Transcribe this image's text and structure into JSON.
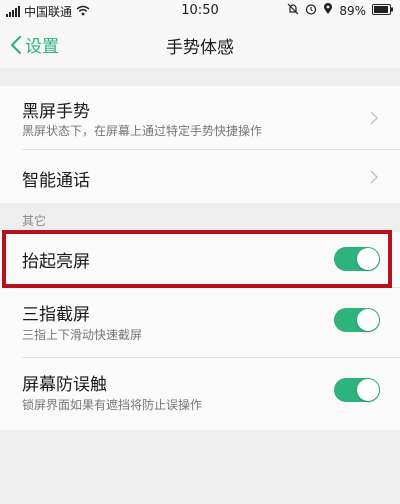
{
  "status_bar": {
    "carrier": "中国联通",
    "time": "10:50",
    "battery": "89%",
    "icons": [
      "signal-icon",
      "wifi-icon",
      "mute-bell-icon",
      "alarm-icon",
      "location-icon",
      "battery-icon"
    ]
  },
  "nav": {
    "back_label": "设置",
    "title": "手势体感"
  },
  "groups": {
    "gestures": [
      {
        "title": "黑屏手势",
        "subtitle": "黑屏状态下，在屏幕上通过特定手势快捷操作"
      },
      {
        "title": "智能通话",
        "subtitle": ""
      }
    ],
    "other_label": "其它",
    "other": [
      {
        "title": "抬起亮屏",
        "subtitle": "",
        "enabled": true
      },
      {
        "title": "三指截屏",
        "subtitle": "三指上下滑动快速截屏",
        "enabled": true
      },
      {
        "title": "屏幕防误触",
        "subtitle": "锁屏界面如果有遮挡将防止误操作",
        "enabled": true
      }
    ]
  },
  "colors": {
    "accent": "#2fb37e",
    "highlight_border": "#b5121b",
    "background": "#eeeeef"
  }
}
